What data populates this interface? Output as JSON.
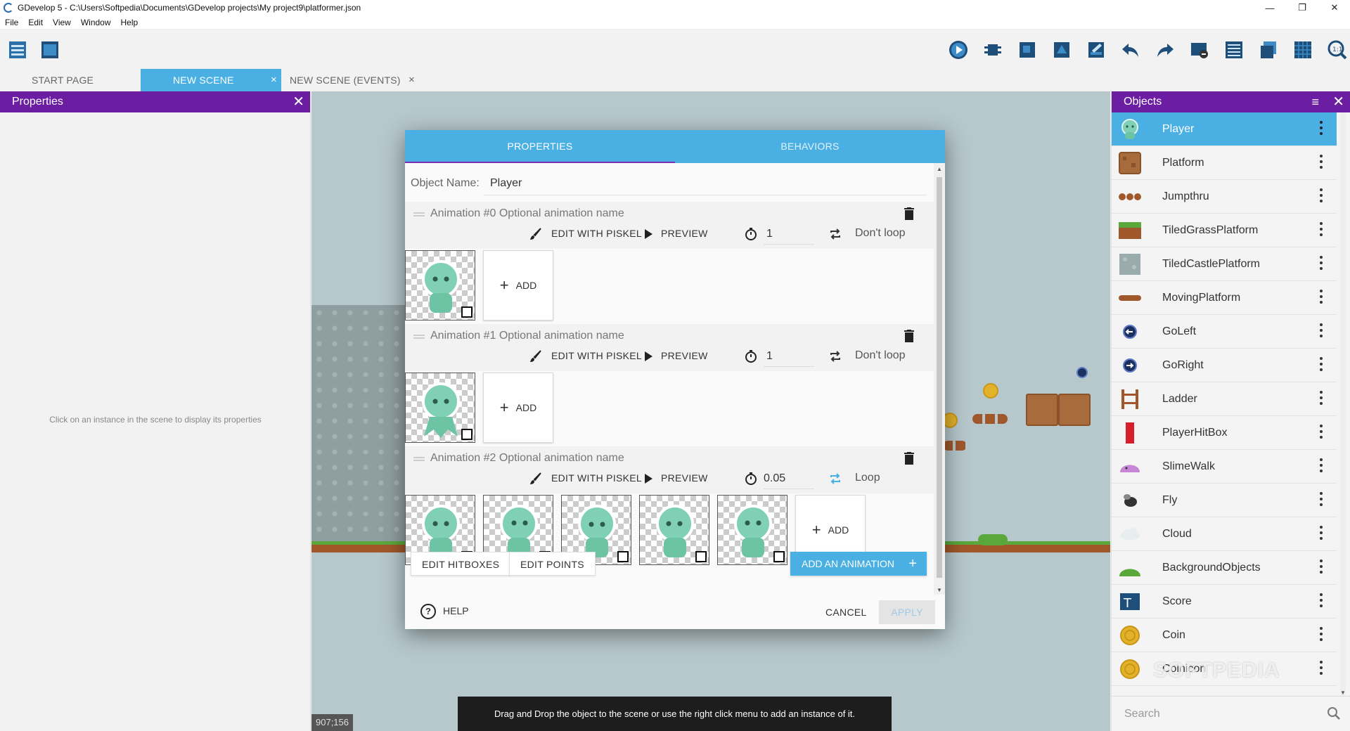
{
  "window": {
    "title": "GDevelop 5 - C:\\Users\\Softpedia\\Documents\\GDevelop projects\\My project9\\platformer.json",
    "minimize": "—",
    "maximize": "❐",
    "close": "✕"
  },
  "menu": [
    "File",
    "Edit",
    "View",
    "Window",
    "Help"
  ],
  "tabs": [
    {
      "label": "START PAGE"
    },
    {
      "label": "NEW SCENE",
      "close": "×"
    },
    {
      "label": "NEW SCENE (EVENTS)",
      "close": "×"
    }
  ],
  "properties_panel": {
    "title": "Properties",
    "empty_message": "Click on an instance in the scene to display its properties"
  },
  "scene": {
    "coordinates": "907;156",
    "tooltip": "Drag and Drop the object to the scene or use the right click menu to add an instance of it."
  },
  "dialog": {
    "tabs": [
      "PROPERTIES",
      "BEHAVIORS"
    ],
    "object_name_label": "Object Name:",
    "object_name_value": "Player",
    "animations": [
      {
        "title": "Animation #0 Optional animation name",
        "edit": "EDIT WITH PISKEL",
        "preview": "PREVIEW",
        "time": "1",
        "loop": "Don't loop",
        "frames": 1,
        "add": "ADD"
      },
      {
        "title": "Animation #1 Optional animation name",
        "edit": "EDIT WITH PISKEL",
        "preview": "PREVIEW",
        "time": "1",
        "loop": "Don't loop",
        "frames": 1,
        "add": "ADD"
      },
      {
        "title": "Animation #2 Optional animation name",
        "edit": "EDIT WITH PISKEL",
        "preview": "PREVIEW",
        "time": "0.05",
        "loop": "Loop",
        "frames": 5,
        "add": "ADD"
      }
    ],
    "edit_hitboxes": "EDIT HITBOXES",
    "edit_points": "EDIT POINTS",
    "add_animation": "ADD AN ANIMATION",
    "help": "HELP",
    "cancel": "CANCEL",
    "apply": "APPLY"
  },
  "objects_panel": {
    "title": "Objects",
    "search_placeholder": "Search",
    "items": [
      {
        "name": "Player",
        "icon": "player-sprite-icon",
        "selected": true
      },
      {
        "name": "Platform",
        "icon": "crate-icon"
      },
      {
        "name": "Jumpthru",
        "icon": "jumpthru-icon"
      },
      {
        "name": "TiledGrassPlatform",
        "icon": "grass-tile-icon"
      },
      {
        "name": "TiledCastlePlatform",
        "icon": "castle-tile-icon"
      },
      {
        "name": "MovingPlatform",
        "icon": "plank-icon"
      },
      {
        "name": "GoLeft",
        "icon": "arrow-left-ball-icon"
      },
      {
        "name": "GoRight",
        "icon": "arrow-right-ball-icon"
      },
      {
        "name": "Ladder",
        "icon": "ladder-icon"
      },
      {
        "name": "PlayerHitBox",
        "icon": "hitbox-icon"
      },
      {
        "name": "SlimeWalk",
        "icon": "slime-icon"
      },
      {
        "name": "Fly",
        "icon": "fly-icon"
      },
      {
        "name": "Cloud",
        "icon": "cloud-icon"
      },
      {
        "name": "BackgroundObjects",
        "icon": "bush-icon"
      },
      {
        "name": "Score",
        "icon": "text-icon"
      },
      {
        "name": "Coin",
        "icon": "coin-icon"
      },
      {
        "name": "Coinicon",
        "icon": "coin-icon"
      }
    ]
  },
  "watermark": "SOFTPEDIA",
  "colors": {
    "accent": "#4ab0e4",
    "panel_header": "#6b1ea1",
    "tab_indicator": "#7a2fb8"
  }
}
